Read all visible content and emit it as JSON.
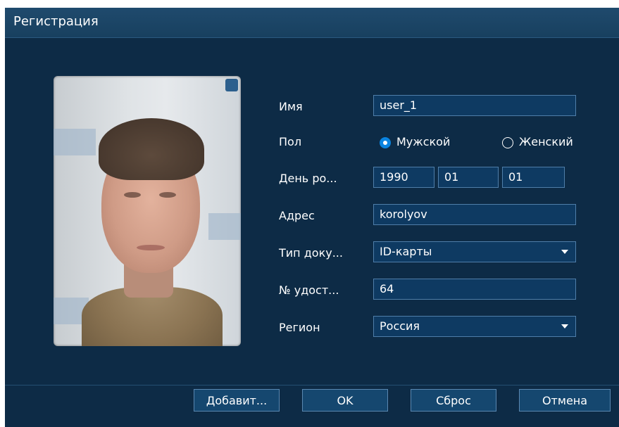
{
  "dialog": {
    "title": "Регистрация"
  },
  "form": {
    "name_label": "Имя",
    "name_value": "user_1",
    "gender_label": "Пол",
    "gender_male": "Мужской",
    "gender_female": "Женский",
    "gender_selected": "Мужской",
    "birthday_label": "День ро...",
    "birthday_year": "1990",
    "birthday_month": "01",
    "birthday_day": "01",
    "address_label": "Адрес",
    "address_value": "korolyov",
    "doc_type_label": "Тип доку...",
    "doc_type_value": "ID-карты",
    "id_number_label": "№ удост...",
    "id_number_value": "64",
    "region_label": "Регион",
    "region_value": "Россия"
  },
  "buttons": {
    "add": "Добавит...",
    "ok": "OK",
    "reset": "Сброс",
    "cancel": "Отмена"
  },
  "colors": {
    "background": "#0d2b46",
    "titlebar": "#1f4a6d",
    "field_bg": "#0e3a62",
    "field_border": "#4f7ea9",
    "radio_selected": "#0a84e0"
  }
}
